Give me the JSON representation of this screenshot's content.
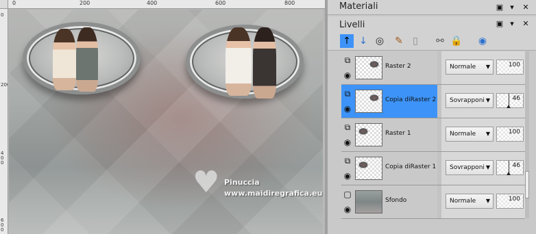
{
  "ruler": {
    "top_labels": [
      "0",
      "200",
      "400",
      "600",
      "800"
    ],
    "left_labels": [
      "0",
      "200",
      "4 0 0",
      "6 0 0"
    ]
  },
  "watermark": {
    "name": "Pinuccia",
    "url": "www.maidiregrafica.eu"
  },
  "panels": {
    "materials_title": "Materiali",
    "layers_title": "Livelli",
    "window_controls": [
      "dock-icon",
      "menu-icon",
      "close-icon"
    ]
  },
  "toolbar": {
    "buttons": [
      {
        "name": "move-layer-up-icon",
        "glyph": "↑"
      },
      {
        "name": "move-layer-down-icon",
        "glyph": "↓"
      },
      {
        "name": "show-hide-layer-icon",
        "glyph": "◎"
      },
      {
        "name": "edit-selection-icon",
        "glyph": "✎"
      },
      {
        "name": "delete-layer-icon",
        "glyph": "▯"
      },
      {
        "name": "link-layers-icon",
        "glyph": "⚯"
      },
      {
        "name": "lock-transparency-icon",
        "glyph": "🔒"
      },
      {
        "name": "layer-properties-icon",
        "glyph": "◉"
      }
    ]
  },
  "layers": [
    {
      "name": "Raster 2",
      "blend": "Normale",
      "opacity": "100",
      "selected": false,
      "thumb": "transparent"
    },
    {
      "name": "Copia diRaster 2",
      "blend": "Sovrapponi",
      "opacity": "46",
      "selected": true,
      "thumb": "transparent"
    },
    {
      "name": "Raster 1",
      "blend": "Normale",
      "opacity": "100",
      "selected": false,
      "thumb": "transparent"
    },
    {
      "name": "Copia diRaster 1",
      "blend": "Sovrapponi",
      "opacity": "46",
      "selected": false,
      "thumb": "transparent"
    },
    {
      "name": "Sfondo",
      "blend": "Normale",
      "opacity": "100",
      "selected": false,
      "thumb": "background"
    }
  ],
  "colors": {
    "selected_row": "#3d93f7",
    "panel_bg": "#c9c9c9"
  }
}
